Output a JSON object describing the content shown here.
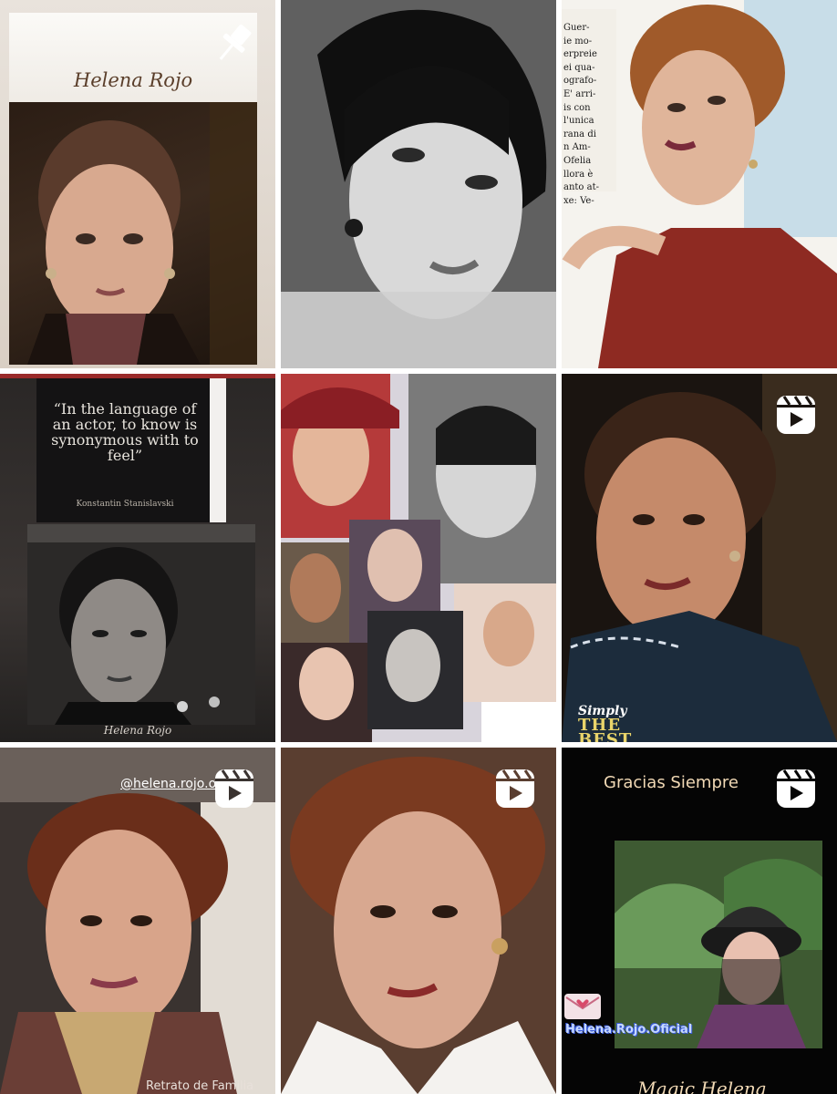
{
  "grid": {
    "tiles": [
      {
        "id": 1,
        "type": "image",
        "name_label": "Helena Rojo",
        "badge": "pin-icon"
      },
      {
        "id": 2,
        "type": "image"
      },
      {
        "id": 3,
        "type": "image",
        "scrap_text": "Guer-\nie mo-\nerpreie\nei qua-\nografo-\nE' arri-\nis con\nl'unica\nrana di\nn Am-\nOfelia\nllora è\nanto at-\nxe: Ve-"
      },
      {
        "id": 4,
        "type": "image",
        "quote": "“In the language of an actor, to know is synonymous with to feel”",
        "quote_author": "Konstantin Stanislavski",
        "signature": "Helena Rojo"
      },
      {
        "id": 5,
        "type": "image"
      },
      {
        "id": 6,
        "type": "reel",
        "badge": "reel-icon",
        "overlay_line1": "Simply",
        "overlay_line2": "THE BEST"
      },
      {
        "id": 7,
        "type": "reel",
        "badge": "reel-icon",
        "handle": "@helena.rojo.oficial",
        "caption": "Retrato de Familia"
      },
      {
        "id": 8,
        "type": "reel",
        "badge": "reel-icon"
      },
      {
        "id": 9,
        "type": "reel",
        "badge": "reel-icon",
        "title": "Gracias Siempre",
        "handle": "Helena.Rojo.Oficial",
        "footer": "Magic Helena"
      }
    ]
  }
}
